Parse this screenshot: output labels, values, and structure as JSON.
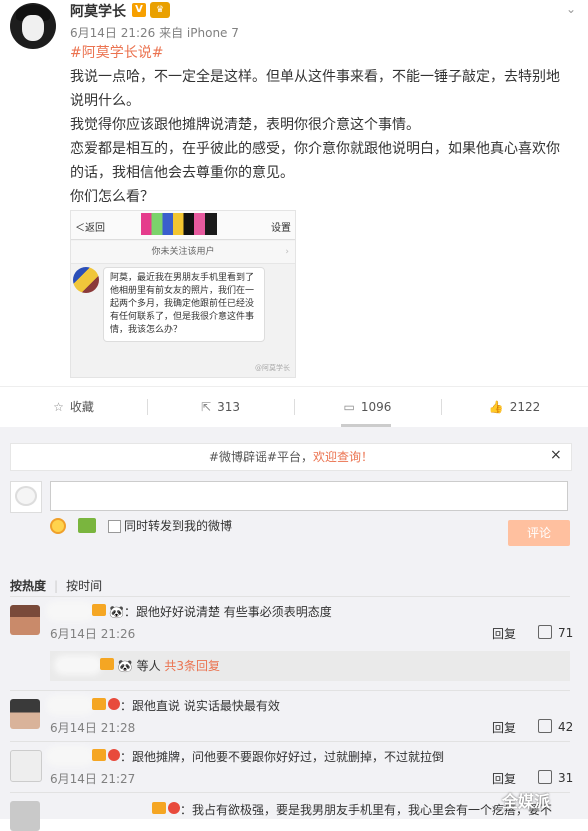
{
  "post": {
    "username": "阿莫学长",
    "v_badge": "V",
    "vip_badge": "♛",
    "meta": "6月14日 21:26 来自 iPhone 7",
    "more": "⌄",
    "topic": "#阿莫学长说#",
    "paragraphs": [
      "我说一点哈，不一定全是这样。但单从这件事来看，不能一锤子敲定，去特别地说明什么。",
      "我觉得你应该跟他摊牌说清楚，表明你很介意这个事情。",
      "恋爱都是相互的，在乎彼此的感受，你介意你就跟他说明白，如果他真心喜欢你的话，我相信他会去尊重你的意见。",
      "你们怎么看？"
    ],
    "embed": {
      "back": "＜返回",
      "settings": "设置",
      "follow_text": "你未关注该用户",
      "chevron": "›",
      "message": "阿莫，最近我在男朋友手机里看到了他相册里有前女友的照片，我们在一起两个多月，我确定他跟前任已经没有任何联系了，但是我很介意这件事情，我该怎么办？",
      "watermark": "@阿莫学长"
    }
  },
  "actions": {
    "collect": "收藏",
    "repost": "313",
    "comment": "1096",
    "like": "2122"
  },
  "comment_box": {
    "notice_pre": "#微博辟谣#平台，",
    "notice_hl": "欢迎查询！",
    "close": "×",
    "forward_label": "同时转发到我的微博",
    "submit": "评论"
  },
  "sort": {
    "hot": "按热度",
    "time": "按时间"
  },
  "comments": [
    {
      "text": "：跟他好好说清楚 有些事必须表明态度",
      "time": "6月14日 21:26",
      "reply": "回复",
      "likes": "71",
      "sub": {
        "suffix": "等人",
        "link": "共3条回复"
      }
    },
    {
      "text": "：跟他直说 说实话最快最有效",
      "time": "6月14日 21:28",
      "reply": "回复",
      "likes": "42"
    },
    {
      "text": "：跟他摊牌，问他要不要跟你好好过，过就删掉，不过就拉倒",
      "time": "6月14日 21:27",
      "reply": "回复",
      "likes": "31"
    },
    {
      "text": "：我占有欲极强，要是我男朋友手机里有，我心里会有一个疙瘩，要不"
    }
  ],
  "watermark_logo": "全媒派",
  "colors": {
    "accent": "#eb7350",
    "submit_bg": "#ffc09f",
    "comment_bg": "#f2f2f5"
  }
}
